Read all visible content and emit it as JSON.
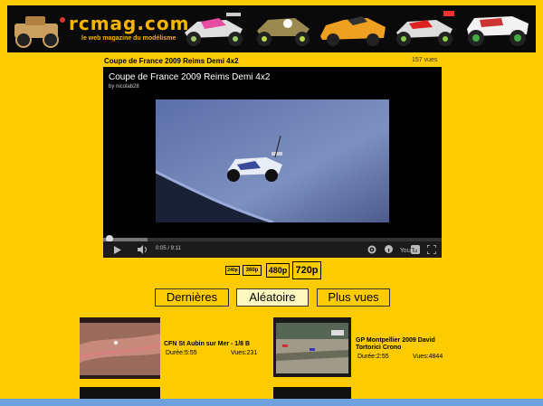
{
  "site": {
    "logo_text": "rcmag.com",
    "tagline": "le web magazine du modélisme"
  },
  "video": {
    "title": "Coupe de France 2009 Reims Demi 4x2",
    "views": "157 vues",
    "player_title": "Coupe de France 2009 Reims Demi 4x2",
    "player_by": "by nicolab28",
    "time": "0:05 / 9:11",
    "progress": 0.01
  },
  "quality": [
    "240p",
    "360p",
    "480p",
    "720p"
  ],
  "tabs": [
    {
      "label": "Dernières",
      "active": false
    },
    {
      "label": "Aléatoire",
      "active": true
    },
    {
      "label": "Plus vues",
      "active": false
    }
  ],
  "items": [
    {
      "title_line1": "CFN St Aubin sur Mer - 1/8 B",
      "title_line2": "",
      "duration": "Durée:5:55",
      "views": "Vues:231"
    },
    {
      "title_line1": "GP Montpellier 2009 David",
      "title_line2": "Tortorici Crono",
      "duration": "Durée:2:55",
      "views": "Vues:4844"
    }
  ]
}
